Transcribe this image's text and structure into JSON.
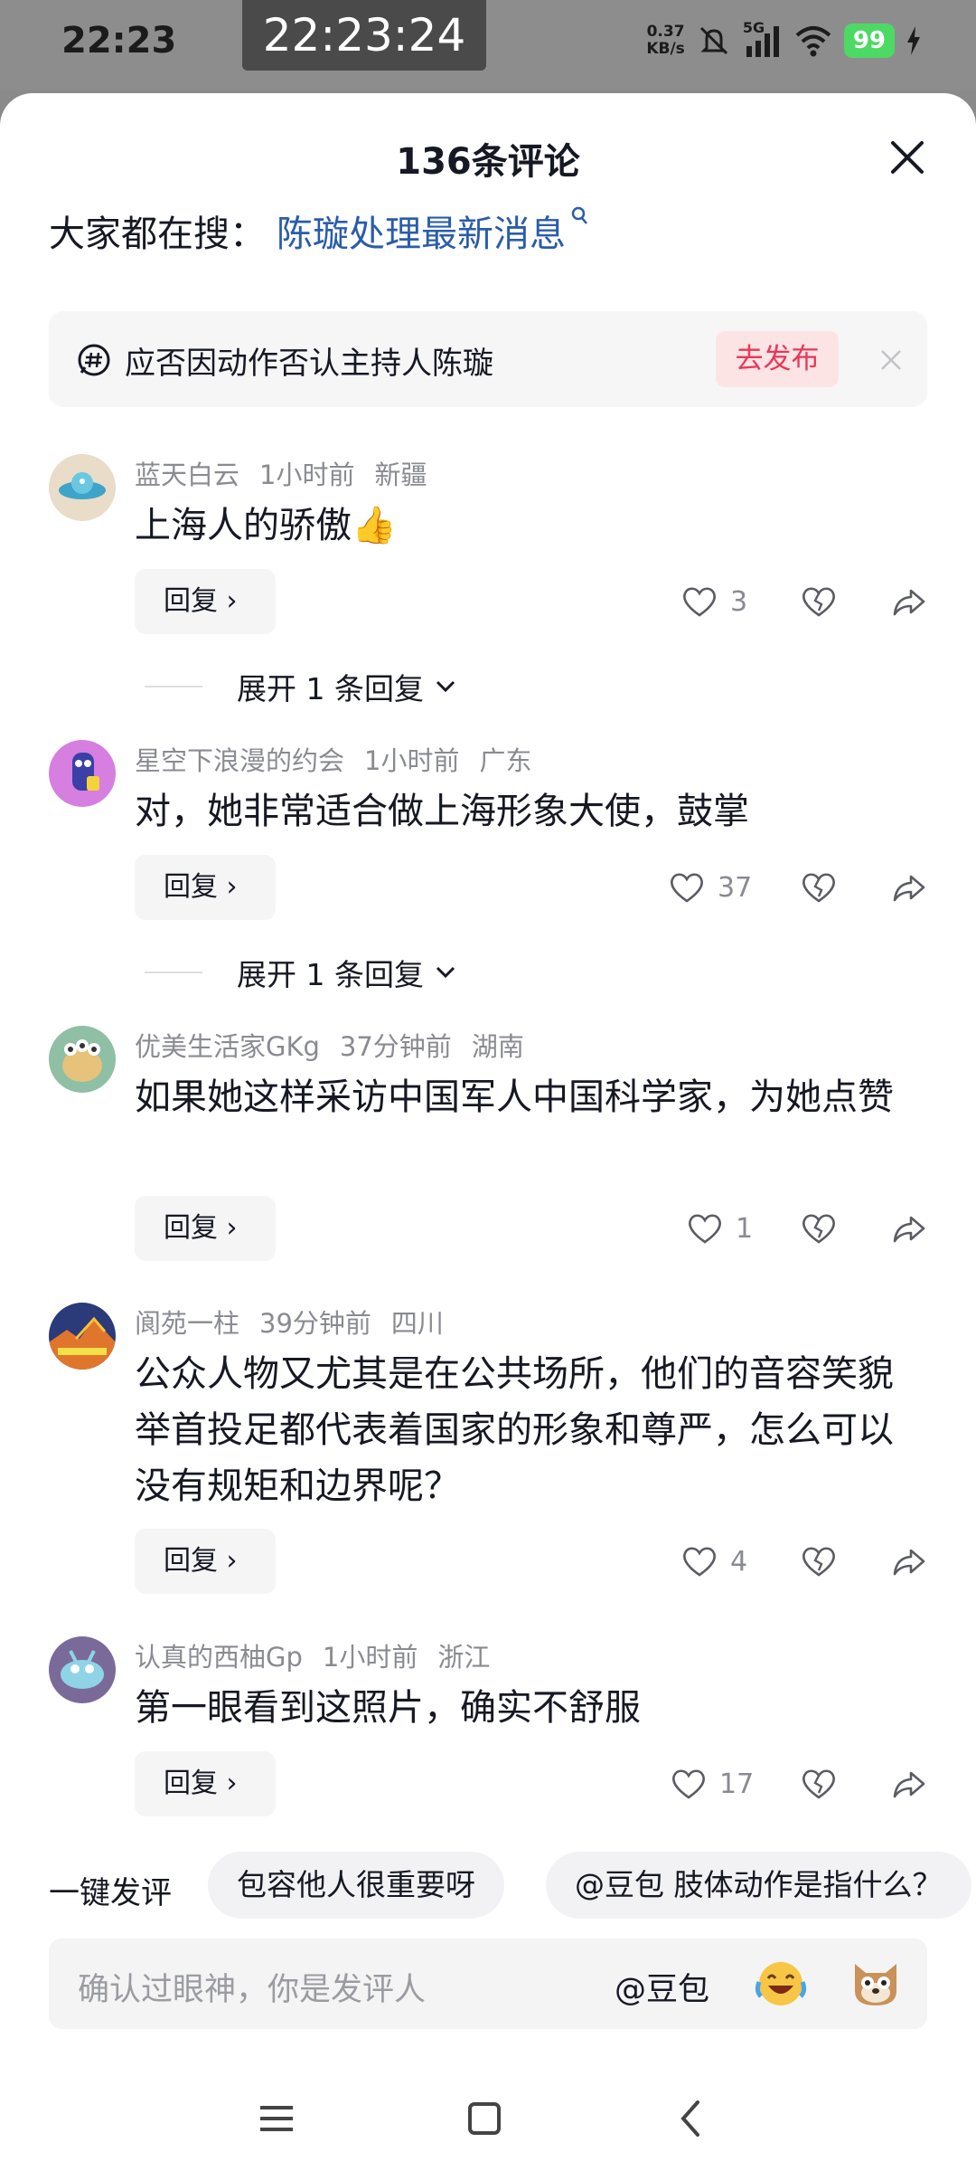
{
  "status_bar": {
    "time": "22:23",
    "clock_overlay": "22:23:24",
    "net_speed_value": "0.37",
    "net_speed_unit": "KB/s",
    "network": "5G",
    "battery": "99"
  },
  "sheet": {
    "title": "136条评论",
    "search_hint_label": "大家都在搜：",
    "search_hint_link": "陈璇处理最新消息"
  },
  "topic": {
    "text": "应否因动作否认主持人陈璇",
    "publish_label": "去发布"
  },
  "comments": [
    {
      "user": "蓝天白云",
      "time": "1小时前",
      "location": "新疆",
      "text": "上海人的骄傲👍",
      "likes": "3",
      "reply_label": "回复",
      "expand": "展开 1 条回复"
    },
    {
      "user": "星空下浪漫的约会",
      "time": "1小时前",
      "location": "广东",
      "text": "对，她非常适合做上海形象大使，鼓掌",
      "likes": "37",
      "reply_label": "回复",
      "expand": "展开 1 条回复"
    },
    {
      "user": "优美生活家GKg",
      "time": "37分钟前",
      "location": "湖南",
      "text": "如果她这样采访中国军人中国科学家，为她点赞",
      "likes": "1",
      "reply_label": "回复"
    },
    {
      "user": "阆苑一柱",
      "time": "39分钟前",
      "location": "四川",
      "text": "公众人物又尤其是在公共场所，他们的音容笑貌举首投足都代表着国家的形象和尊严，怎么可以没有规矩和边界呢？",
      "likes": "4",
      "reply_label": "回复"
    },
    {
      "user": "认真的西柚Gp",
      "time": "1小时前",
      "location": "浙江",
      "text": "第一眼看到这照片，确实不舒服",
      "likes": "17",
      "reply_label": "回复"
    }
  ],
  "quick_comment": {
    "label": "一键发评",
    "chips": [
      "包容他人很重要呀",
      "@豆包 肢体动作是指什么？"
    ]
  },
  "input": {
    "placeholder": "确认过眼神，你是发评人",
    "at_label": "@豆包"
  },
  "colors": {
    "link": "#2a5caa",
    "publish_bg": "#fde4e4",
    "publish_text": "#e8385a",
    "battery": "#4cd964"
  }
}
